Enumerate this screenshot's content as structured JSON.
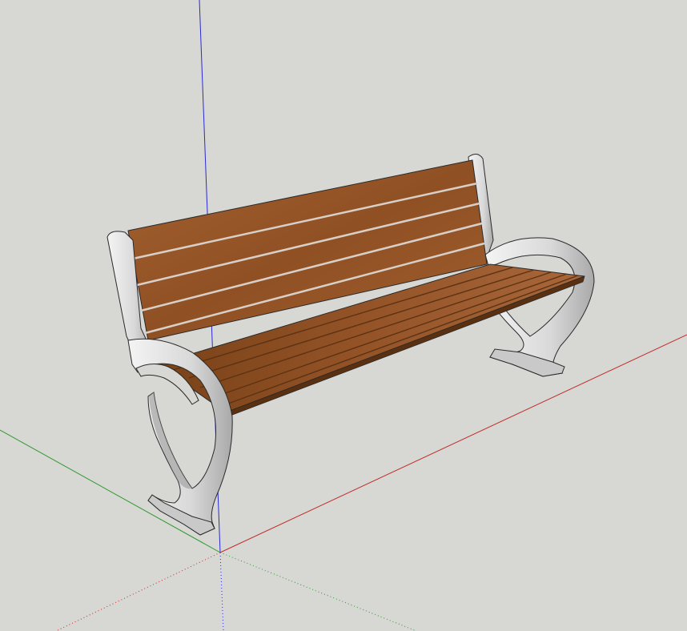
{
  "viewport": {
    "background": "#d7d7d4"
  },
  "axes": {
    "red": "#c0302a",
    "green": "#2f9a2f",
    "blue": "#2a2ad0"
  },
  "model": {
    "object": "bench-icon",
    "wood_color": "#9a5a2c",
    "wood_dark": "#6e3c18",
    "frame_color": "#e6e6e6",
    "frame_shadow": "#9a9a9a",
    "outline": "#2a2a2a"
  }
}
